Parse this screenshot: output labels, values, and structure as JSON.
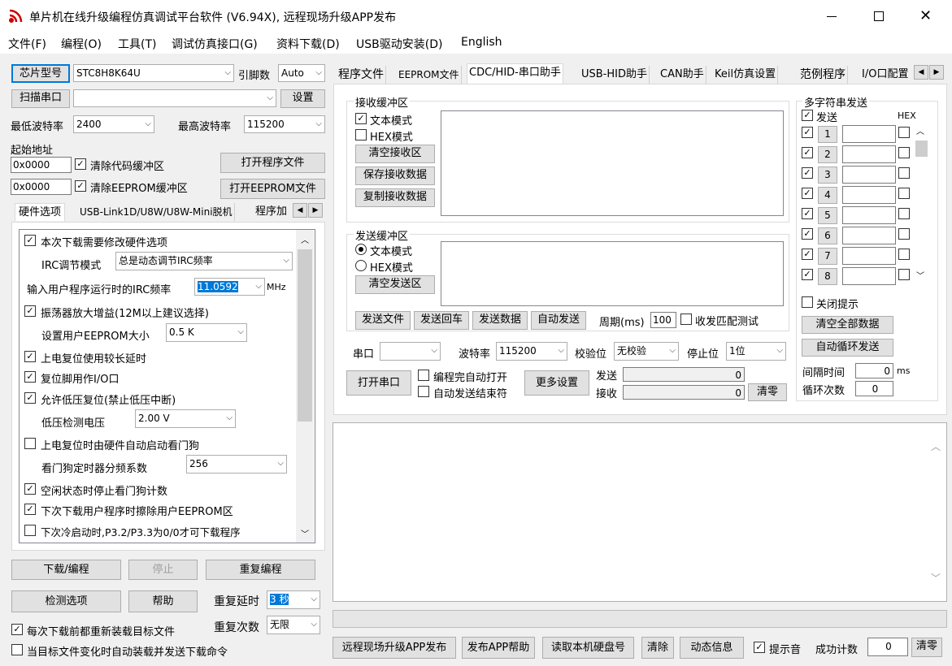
{
  "window": {
    "title": "单片机在线升级编程仿真调试平台软件 (V6.94X), 远程现场升级APP发布"
  },
  "menu": [
    "文件(F)",
    "编程(O)",
    "工具(T)",
    "调试仿真接口(G)",
    "资料下载(D)",
    "USB驱动安装(D)",
    "English"
  ],
  "left": {
    "chip_btn": "芯片型号",
    "chip_value": "STC8H8K64U",
    "pins_label": "引脚数",
    "pins_value": "Auto",
    "scan_btn": "扫描串口",
    "port_value": "",
    "settings_btn": "设置",
    "min_baud_label": "最低波特率",
    "min_baud": "2400",
    "max_baud_label": "最高波特率",
    "max_baud": "115200",
    "start_addr_label": "起始地址",
    "addr1": "0x0000",
    "clear_code": "清除代码缓冲区",
    "open_prog": "打开程序文件",
    "addr2": "0x0000",
    "clear_eeprom": "清除EEPROM缓冲区",
    "open_eeprom": "打开EEPROM文件",
    "tabs": [
      "硬件选项",
      "USB-Link1D/U8W/U8W-Mini脱机",
      "程序加"
    ],
    "hw": {
      "opt1": "本次下载需要修改硬件选项",
      "irc_mode_label": "IRC调节模式",
      "irc_mode": "总是动态调节IRC频率",
      "irc_freq_label": "输入用户程序运行时的IRC频率",
      "irc_freq": "11.0592",
      "irc_unit": "MHz",
      "opt_osc": "振荡器放大增益(12M以上建议选择)",
      "eeprom_size_label": "设置用户EEPROM大小",
      "eeprom_size": "0.5 K",
      "opt_por": "上电复位使用较长延时",
      "opt_rst": "复位脚用作I/O口",
      "opt_lvr": "允许低压复位(禁止低压中断)",
      "lvd_label": "低压检测电压",
      "lvd": "2.00 V",
      "opt_wdt": "上电复位时由硬件自动启动看门狗",
      "wdt_div_label": "看门狗定时器分频系数",
      "wdt_div": "256",
      "opt_idle": "空闲状态时停止看门狗计数",
      "opt_erase": "下次下载用户程序时擦除用户EEPROM区",
      "opt_cold": "下次冷启动时,P3.2/P3.3为0/0才可下载程序"
    },
    "download_btn": "下载/编程",
    "stop_btn": "停止",
    "repeat_btn": "重复编程",
    "check_btn": "检测选项",
    "help_btn": "帮助",
    "repeat_delay_label": "重复延时",
    "repeat_delay": "3 秒",
    "repeat_count_label": "重复次数",
    "repeat_count": "无限",
    "reload_label": "每次下载前都重新装载目标文件",
    "auto_send_label": "当目标文件变化时自动装载并发送下载命令"
  },
  "right": {
    "tabs": [
      "程序文件",
      "EEPROM文件",
      "CDC/HID-串口助手",
      "USB-HID助手",
      "CAN助手",
      "Keil仿真设置",
      "范例程序",
      "I/O口配置"
    ],
    "recv": {
      "group": "接收缓冲区",
      "text_mode": "文本模式",
      "hex_mode": "HEX模式",
      "clear": "清空接收区",
      "save": "保存接收数据",
      "copy": "复制接收数据"
    },
    "send": {
      "group": "发送缓冲区",
      "text_mode": "文本模式",
      "hex_mode": "HEX模式",
      "clear": "清空发送区",
      "send_file": "发送文件",
      "send_cr": "发送回车",
      "send_data": "发送数据",
      "auto_send": "自动发送",
      "period_label": "周期(ms)",
      "period": "100",
      "match_test": "收发匹配测试"
    },
    "port_label": "串口",
    "port": "",
    "baud_label": "波特率",
    "baud": "115200",
    "parity_label": "校验位",
    "parity": "无校验",
    "stop_label": "停止位",
    "stop": "1位",
    "open_port": "打开串口",
    "auto_open": "编程完自动打开",
    "auto_end": "自动发送结束符",
    "more": "更多设置",
    "send_cnt_label": "发送",
    "send_cnt": "0",
    "recv_cnt_label": "接收",
    "recv_cnt": "0",
    "clear_cnt": "清零",
    "multi": {
      "group": "多字符串发送",
      "send": "发送",
      "hex": "HEX",
      "rows": [
        "1",
        "2",
        "3",
        "4",
        "5",
        "6",
        "7",
        "8"
      ],
      "close_hint": "关闭提示",
      "clear_all": "清空全部数据",
      "loop_send": "自动循环发送",
      "interval_label": "间隔时间",
      "interval": "0",
      "interval_unit": "ms",
      "loop_label": "循环次数",
      "loop": "0"
    }
  },
  "bottom": {
    "publish": "远程现场升级APP发布",
    "publish_help": "发布APP帮助",
    "read_disk": "读取本机硬盘号",
    "clear": "清除",
    "dynamic": "动态信息",
    "sound": "提示音",
    "success_label": "成功计数",
    "success": "0",
    "reset": "清零"
  }
}
